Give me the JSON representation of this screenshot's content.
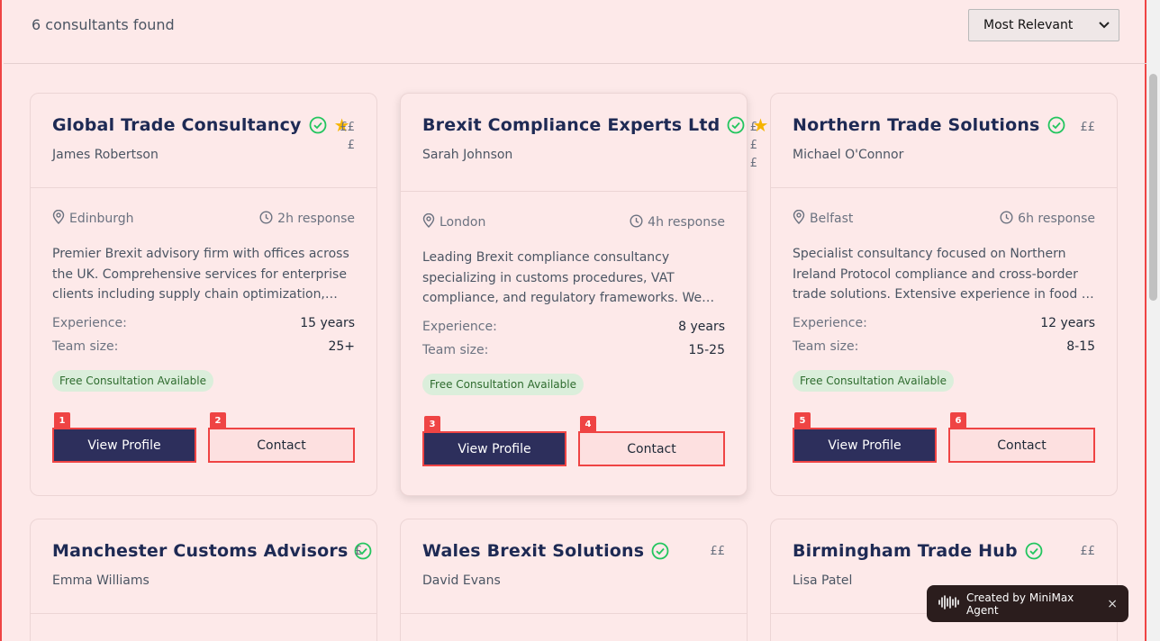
{
  "results": {
    "count_text": "6 consultants found"
  },
  "sort": {
    "selected": "Most Relevant"
  },
  "labels": {
    "experience": "Experience:",
    "team_size": "Team size:",
    "view_profile": "View Profile",
    "contact": "Contact"
  },
  "cards": [
    {
      "name": "Global Trade Consultancy",
      "verified": true,
      "featured": true,
      "price_lines": [
        "££",
        "£"
      ],
      "contact": "James Robertson",
      "location": "Edinburgh",
      "response": "2h response",
      "description": "Premier Brexit advisory firm with offices across the UK. Comprehensive services for enterprise clients including supply chain optimization,…",
      "experience": "15 years",
      "team_size": "25+",
      "badge": "Free Consultation Available",
      "tag_view": "1",
      "tag_contact": "2"
    },
    {
      "name": "Brexit Compliance Experts Ltd",
      "verified": true,
      "featured": true,
      "price_lines": [
        "£",
        "£",
        "£"
      ],
      "contact": "Sarah Johnson",
      "location": "London",
      "response": "4h response",
      "description": "Leading Brexit compliance consultancy specializing in customs procedures, VAT compliance, and regulatory frameworks. We…",
      "experience": "8 years",
      "team_size": "15-25",
      "badge": "Free Consultation Available",
      "tag_view": "3",
      "tag_contact": "4"
    },
    {
      "name": "Northern Trade Solutions",
      "verified": true,
      "featured": false,
      "price_lines": [
        "££"
      ],
      "contact": "Michael O'Connor",
      "location": "Belfast",
      "response": "6h response",
      "description": "Specialist consultancy focused on Northern Ireland Protocol compliance and cross-border trade solutions. Extensive experience in food …",
      "experience": "12 years",
      "team_size": "8-15",
      "badge": "Free Consultation Available",
      "tag_view": "5",
      "tag_contact": "6"
    },
    {
      "name": "Manchester Customs Advisors",
      "verified": true,
      "featured": false,
      "price_lines": [
        "£"
      ],
      "contact": "Emma Williams"
    },
    {
      "name": "Wales Brexit Solutions",
      "verified": true,
      "featured": false,
      "price_lines": [
        "££"
      ],
      "contact": "David Evans"
    },
    {
      "name": "Birmingham Trade Hub",
      "verified": true,
      "featured": false,
      "price_lines": [
        "££"
      ],
      "contact": "Lisa Patel"
    }
  ],
  "toast": {
    "text": "Created by MiniMax Agent",
    "close": "×"
  },
  "colors": {
    "accent": "#ef4444",
    "primary_button": "#2d2f5c",
    "title": "#1e2a54",
    "verified": "#22c55e",
    "star": "#f5b400"
  }
}
